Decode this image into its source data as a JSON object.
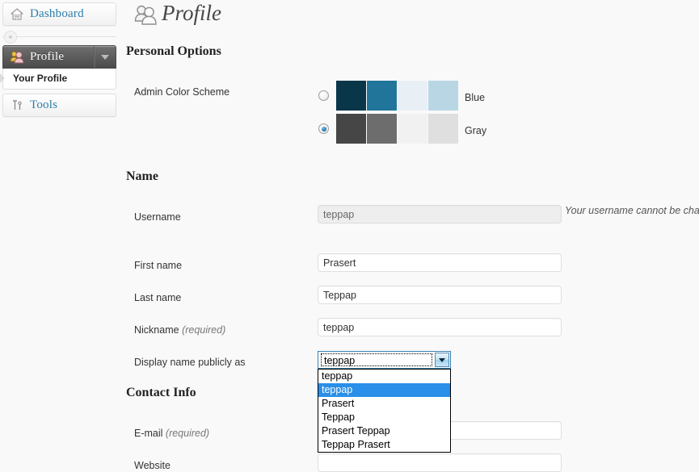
{
  "sidebar": {
    "dashboard": {
      "label": "Dashboard",
      "icon": "dashboard-house-icon"
    },
    "collapse": {
      "label": "«"
    },
    "profile": {
      "label": "Profile",
      "icon": "users-icon"
    },
    "submenu": [
      {
        "label": "Your Profile"
      }
    ],
    "tools": {
      "label": "Tools",
      "icon": "tools-icon"
    }
  },
  "header": {
    "title": "Profile",
    "icon": "users-icon"
  },
  "sections": {
    "personal_options": "Personal Options",
    "name": "Name",
    "contact_info": "Contact Info"
  },
  "color_scheme": {
    "label": "Admin Color Scheme",
    "options": [
      {
        "name": "Blue",
        "selected": false,
        "swatches": [
          "#0a3649",
          "#21759b",
          "#e9f0f5",
          "#b9d6e5"
        ]
      },
      {
        "name": "Gray",
        "selected": true,
        "swatches": [
          "#464646",
          "#6d6d6d",
          "#f1f1f1",
          "#dfdfdf"
        ]
      }
    ]
  },
  "fields": {
    "username": {
      "label": "Username",
      "value": "teppap",
      "disabled": true,
      "help": "Your username cannot be changed."
    },
    "first_name": {
      "label": "First name",
      "value": "Prasert",
      "placeholder": ""
    },
    "last_name": {
      "label": "Last name",
      "value": "Teppap",
      "placeholder": ""
    },
    "nickname": {
      "label": "Nickname",
      "required_note": "(required)",
      "value": "teppap",
      "placeholder": ""
    },
    "display_name": {
      "label": "Display name publicly as",
      "value": "teppap",
      "open": true,
      "options": [
        {
          "label": "teppap",
          "selected": false
        },
        {
          "label": "teppap",
          "selected": true
        },
        {
          "label": "Prasert",
          "selected": false
        },
        {
          "label": "Teppap",
          "selected": false
        },
        {
          "label": "Prasert Teppap",
          "selected": false
        },
        {
          "label": "Teppap Prasert",
          "selected": false
        }
      ]
    },
    "email": {
      "label": "E-mail",
      "required_note": "(required)",
      "value": "",
      "placeholder": ""
    },
    "website": {
      "label": "Website",
      "value": "",
      "placeholder": ""
    }
  },
  "colors": {
    "link": "#2b7eab",
    "highlight": "#2a8fe8",
    "page_bg": "#f9f9f9",
    "focus_border": "#3c7fb1"
  }
}
